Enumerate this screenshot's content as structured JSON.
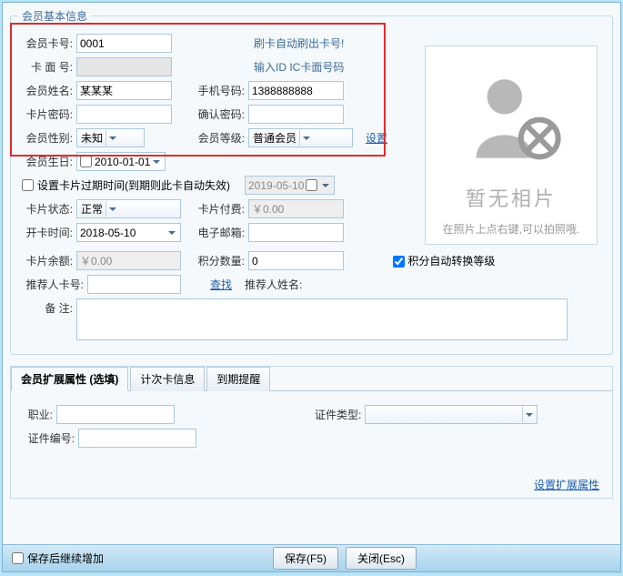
{
  "basic": {
    "legend": "会员基本信息",
    "card_no_label": "会员卡号:",
    "card_no_value": "0001",
    "card_no_hint": "刷卡自动刷出卡号!",
    "face_no_label": "卡 面 号:",
    "face_no_value": "",
    "face_no_hint": "输入ID IC卡面号码",
    "name_label": "会员姓名:",
    "name_value": "某某某",
    "phone_label": "手机号码:",
    "phone_value": "1388888888",
    "pwd_label": "卡片密码:",
    "pwd_value": "",
    "pwd2_label": "确认密码:",
    "pwd2_value": "",
    "gender_label": "会员性别:",
    "gender_value": "未知",
    "level_label": "会员等级:",
    "level_value": "普通会员",
    "level_set_link": "设置",
    "birthday_label": "会员生日:",
    "birthday_value": "2010-01-01",
    "expire_checkbox": "设置卡片过期时间(到期则此卡自动失效)",
    "expire_value": "2019-05-10",
    "status_label": "卡片状态:",
    "status_value": "正常",
    "pay_label": "卡片付费:",
    "pay_value": "￥0.00",
    "open_time_label": "开卡时间:",
    "open_time_value": "2018-05-10",
    "email_label": "电子邮箱:",
    "email_value": "",
    "balance_label": "卡片余额:",
    "balance_value": "￥0.00",
    "points_qty_label": "积分数量:",
    "points_qty_value": "0",
    "auto_convert_label": "积分自动转换等级",
    "referrer_no_label": "推荐人卡号:",
    "referrer_no_value": "",
    "find_link": "查找",
    "referrer_name_label": "推荐人姓名:",
    "memo_label": "备 注:"
  },
  "photo": {
    "no_photo": "暂无相片",
    "tip": "在照片上点右键,可以拍照哦."
  },
  "tabs": {
    "t1": "会员扩展属性 (选填)",
    "t2": "计次卡信息",
    "t3": "到期提醒",
    "occupation_label": "职业:",
    "doc_type_label": "证件类型:",
    "doc_no_label": "证件编号:",
    "set_ext_link": "设置扩展属性"
  },
  "footer": {
    "save_continue": "保存后继续增加",
    "save_btn": "保存(F5)",
    "close_btn": "关闭(Esc)"
  }
}
